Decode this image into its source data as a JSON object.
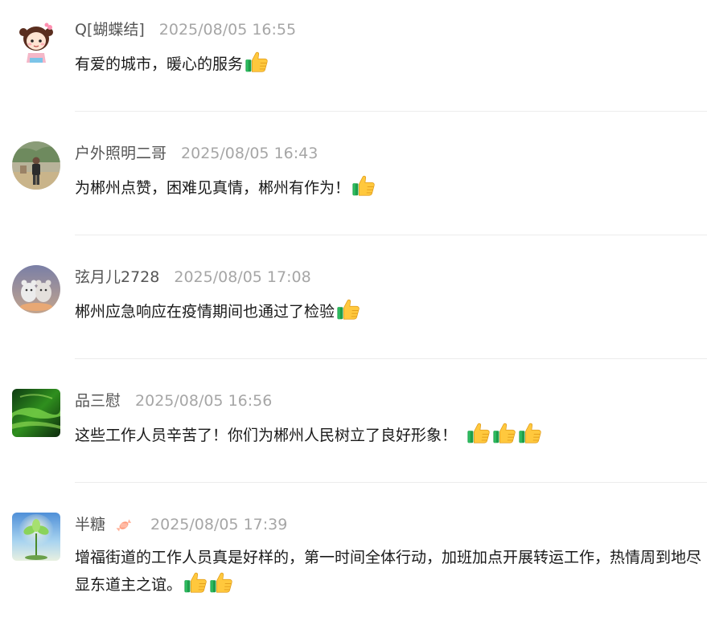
{
  "comments": [
    {
      "username": "Q[蝴蝶结]",
      "time": "2025/08/05 16:55",
      "text": "有爱的城市，暖心的服务",
      "thumbs": 1
    },
    {
      "username": "户外照明二哥",
      "time": "2025/08/05 16:43",
      "text": "为郴州点赞，困难见真情，郴州有作为！",
      "thumbs": 1
    },
    {
      "username": "弦月儿2728",
      "time": "2025/08/05 17:08",
      "text": "郴州应急响应在疫情期间也通过了检验",
      "thumbs": 1
    },
    {
      "username": "品三慰",
      "time": "2025/08/05 16:56",
      "text": "这些工作人员辛苦了！你们为郴州人民树立了良好形象！",
      "thumbs": 3
    },
    {
      "username": "半糖",
      "time": "2025/08/05 17:39",
      "text": "增福街道的工作人员真是好样的，第一时间全体行动，加班加点开展转运工作，热情周到地尽显东道主之谊。",
      "thumbs": 2,
      "badge_icon": "candy-icon"
    }
  ],
  "colors": {
    "username": "#555555",
    "time": "#a6a6a6",
    "text": "#1a1a1a",
    "divider": "#ececec"
  }
}
